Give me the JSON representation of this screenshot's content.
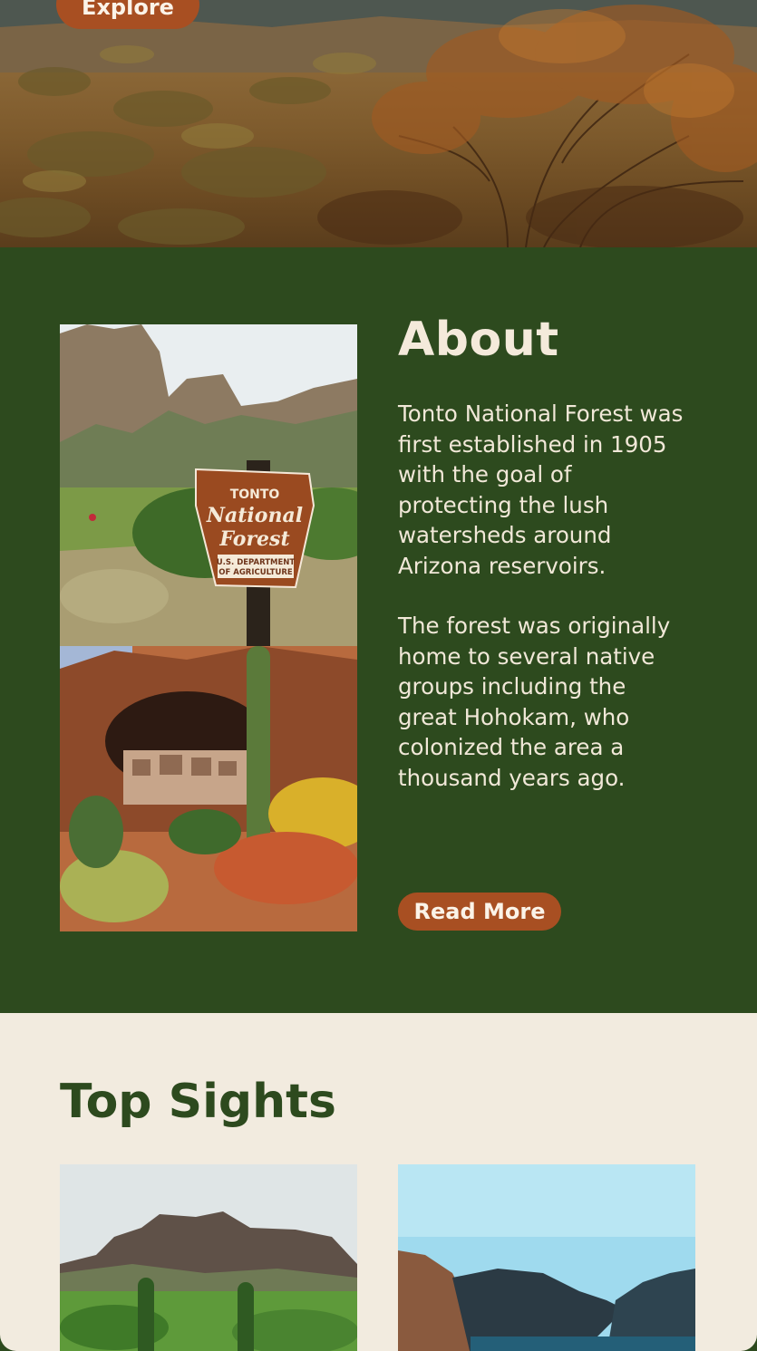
{
  "hero": {
    "explore_label": "Explore"
  },
  "about": {
    "title": "About",
    "paragraph_1": "Tonto National Forest was first established in 1905 with the goal of protecting the lush watersheds around Arizona reservoirs.",
    "paragraph_2": "The forest was originally home to several native groups including the great Hohokam, who colonized the area a thousand years ago.",
    "read_more_label": "Read More",
    "sign": {
      "line1": "TONTO",
      "line2": "National",
      "line3": "Forest",
      "line4": "U.S. DEPARTMENT",
      "line5": "OF AGRICULTURE"
    }
  },
  "top_sights": {
    "title": "Top Sights"
  },
  "colors": {
    "forest_green": "#2d4a1e",
    "rust": "#a84f22",
    "cream": "#f2ebdf"
  }
}
